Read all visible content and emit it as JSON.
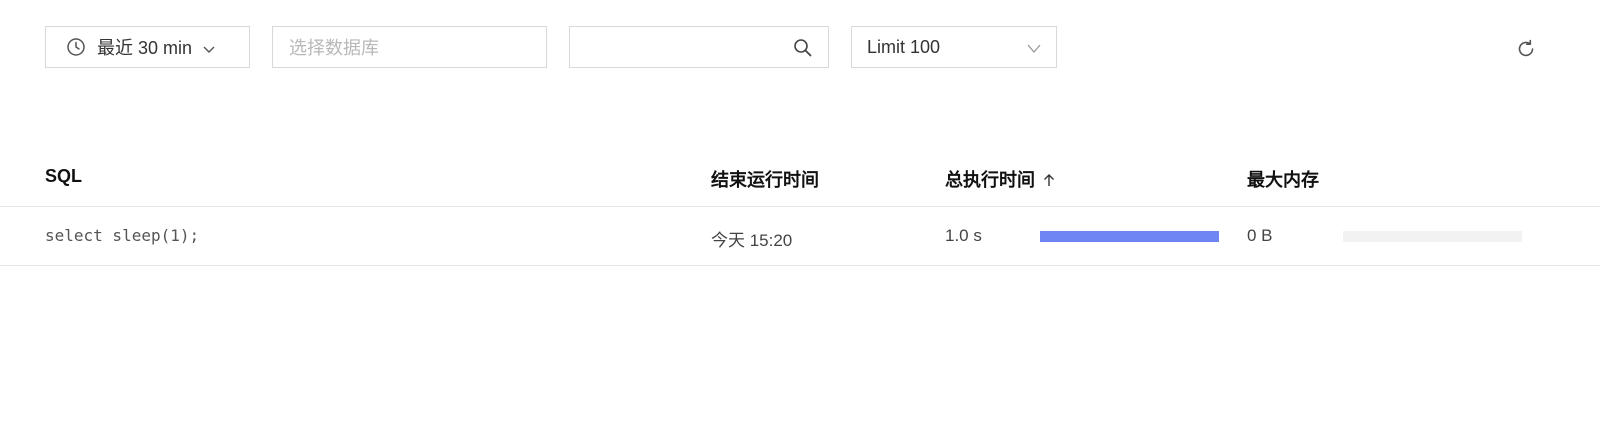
{
  "filters": {
    "time_range": {
      "label": "最近 30 min",
      "icon": "clock-icon"
    },
    "database": {
      "placeholder": "选择数据库",
      "value": ""
    },
    "search": {
      "value": "",
      "icon": "search-icon"
    },
    "limit": {
      "label": "Limit 100"
    }
  },
  "refresh": {
    "icon": "refresh-icon"
  },
  "table": {
    "columns": {
      "sql": "SQL",
      "end_time": "结束运行时间",
      "total_time": "总执行时间",
      "max_memory": "最大内存"
    },
    "sort": {
      "column": "total_time",
      "direction": "ascending"
    },
    "rows": [
      {
        "sql": "select sleep(1);",
        "end_time": "今天 15:20",
        "total_time": "1.0 s",
        "total_time_fraction": 1.0,
        "max_memory": "0 B",
        "max_memory_fraction": 0.0
      }
    ]
  },
  "colors": {
    "bar_fill": "#6f86f2",
    "bar_track": "#f2f2f2",
    "border": "#d9d9d9"
  }
}
